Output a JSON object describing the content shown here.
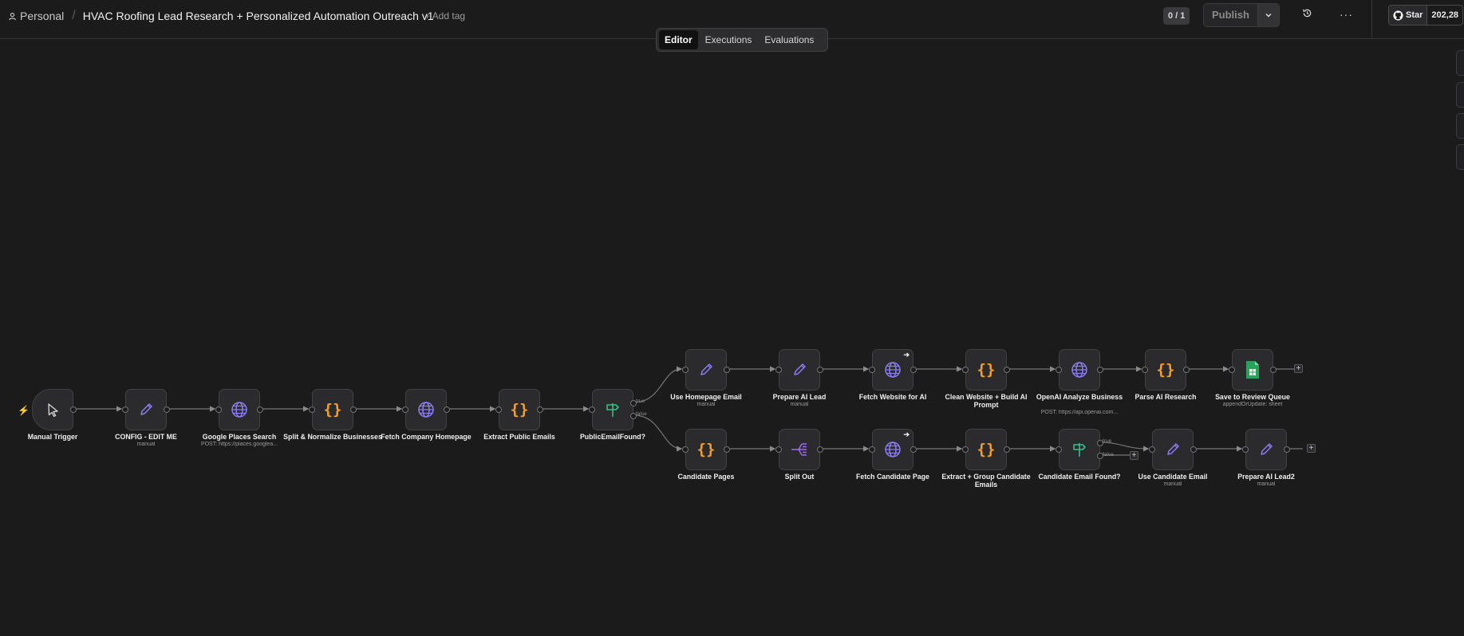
{
  "header": {
    "workspace": "Personal",
    "workflow_title": "HVAC Roofing Lead Research + Personalized Automation Outreach v1",
    "add_tag_label": "+ Add tag",
    "version_counter": "0 / 1",
    "publish_label": "Publish",
    "more_label": "···",
    "star_label": "Star",
    "star_count": "202,28"
  },
  "tabs": [
    "Editor",
    "Executions",
    "Evaluations"
  ],
  "nodes": {
    "manual_trigger": {
      "label": "Manual Trigger",
      "icon": "cursor-icon"
    },
    "config": {
      "label": "CONFIG - EDIT ME",
      "sub": "manual",
      "icon": "pencil-icon"
    },
    "google_places": {
      "label": "Google Places Search",
      "sub": "POST: https://places.googlea...",
      "icon": "globe-icon"
    },
    "split_normalize": {
      "label": "Split & Normalize Businesses",
      "icon": "code-braces-icon"
    },
    "fetch_homepage": {
      "label": "Fetch Company Homepage",
      "icon": "globe-icon"
    },
    "extract_emails": {
      "label": "Extract Public Emails",
      "icon": "code-braces-icon"
    },
    "public_email_found": {
      "label": "PublicEmailFound?",
      "icon": "signpost-icon"
    },
    "use_homepage_email": {
      "label": "Use Homepage Email",
      "sub": "manual",
      "icon": "pencil-icon"
    },
    "prepare_ai_lead": {
      "label": "Prepare AI Lead",
      "sub": "manual",
      "icon": "pencil-icon"
    },
    "fetch_website_ai": {
      "label": "Fetch Website for AI",
      "icon": "globe-icon"
    },
    "clean_website": {
      "label": "Clean Website + Build AI Prompt",
      "icon": "code-braces-icon"
    },
    "openai_analyze": {
      "label": "OpenAI Analyze Business",
      "sub": "POST: https://api.openai.com...",
      "icon": "globe-icon"
    },
    "parse_ai": {
      "label": "Parse AI Research",
      "icon": "code-braces-icon"
    },
    "save_review": {
      "label": "Save to Review Queue",
      "sub": "appendOrUpdate: sheet",
      "icon": "google-sheets-icon"
    },
    "candidate_pages": {
      "label": "Candidate Pages",
      "icon": "code-braces-icon"
    },
    "split_out": {
      "label": "Split Out",
      "icon": "split-out-icon"
    },
    "fetch_candidate": {
      "label": "Fetch Candidate Page",
      "icon": "globe-icon"
    },
    "extract_group": {
      "label": "Extract + Group Candidate Emails",
      "icon": "code-braces-icon"
    },
    "candidate_email_found": {
      "label": "Candidate Email Found?",
      "icon": "signpost-icon"
    },
    "use_candidate_email": {
      "label": "Use Candidate Email",
      "sub": "manual",
      "icon": "pencil-icon"
    },
    "prepare_ai_lead2": {
      "label": "Prepare AI Lead2",
      "sub": "manual",
      "icon": "pencil-icon"
    }
  },
  "branch_labels": {
    "true": "true",
    "false": "false"
  },
  "colors": {
    "accent_purple": "#8b7cf6",
    "code_orange": "#f59f2a",
    "if_green": "#36c08a",
    "sheets_green": "#27a35a",
    "trigger_red": "#e5573d"
  }
}
